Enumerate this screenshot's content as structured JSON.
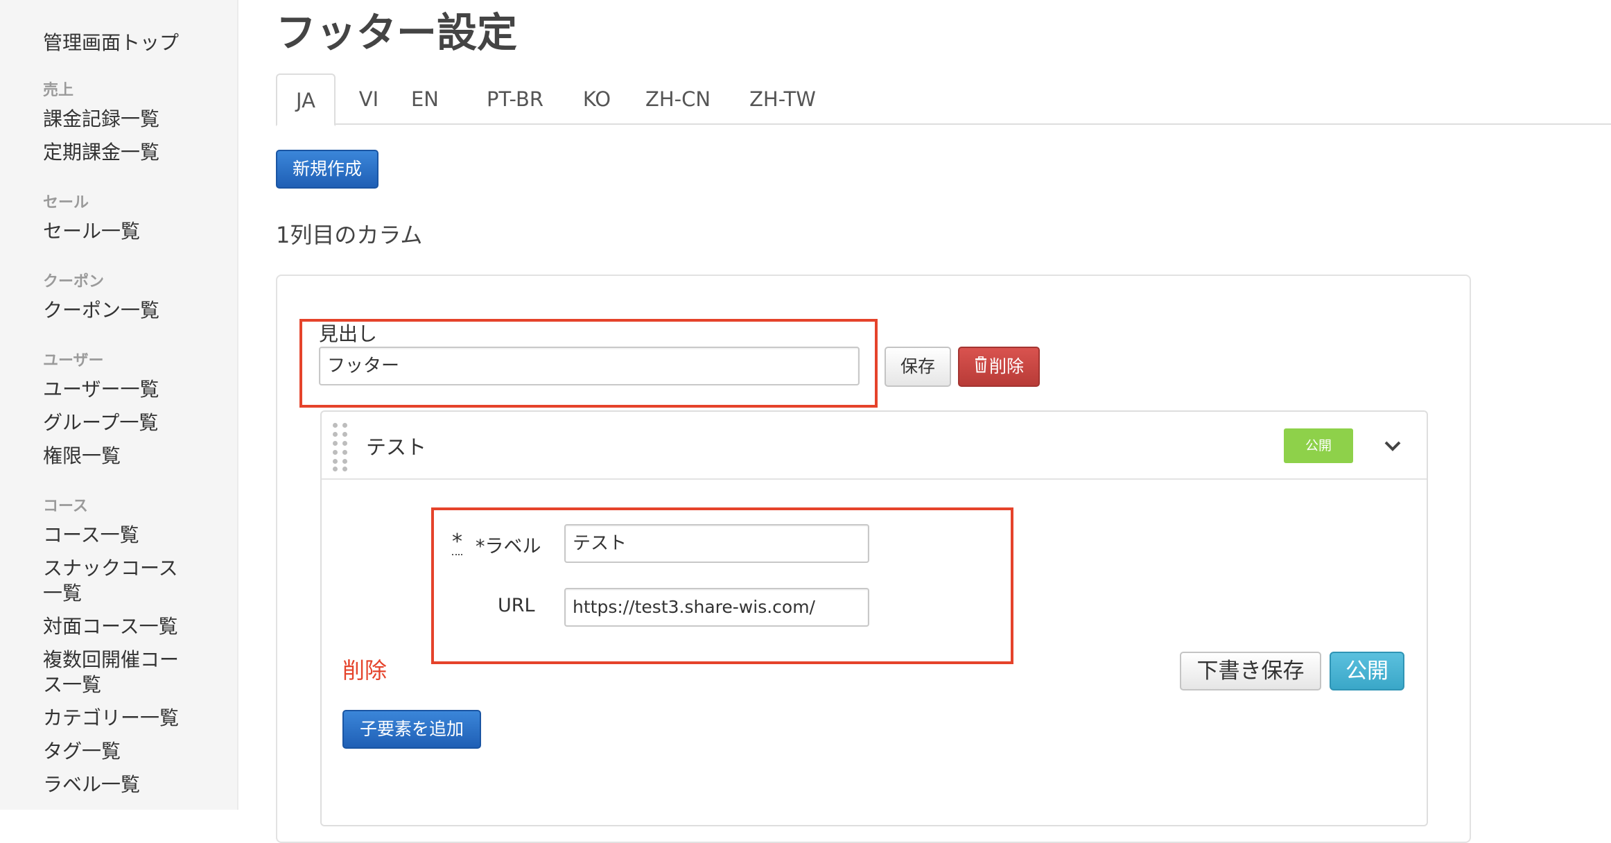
{
  "sidebar": {
    "top": "管理画面トップ",
    "sections": [
      {
        "heading": "売上",
        "items": [
          "課金記録一覧",
          "定期課金一覧"
        ]
      },
      {
        "heading": "セール",
        "items": [
          "セール一覧"
        ]
      },
      {
        "heading": "クーポン",
        "items": [
          "クーポン一覧"
        ]
      },
      {
        "heading": "ユーザー",
        "items": [
          "ユーザー一覧",
          "グループ一覧",
          "権限一覧"
        ]
      },
      {
        "heading": "コース",
        "items": [
          "コース一覧",
          "スナックコース",
          "一覧",
          "対面コース一覧",
          "複数回開催コー",
          "ス一覧",
          "カテゴリー一覧",
          "タグ一覧",
          "ラベル一覧"
        ]
      }
    ]
  },
  "page": {
    "title": "フッター設定",
    "tabs": [
      "JA",
      "VI",
      "EN",
      "PT-BR",
      "KO",
      "ZH-CN",
      "ZH-TW"
    ],
    "new_button": "新規作成",
    "column_title": "1列目のカラム"
  },
  "heading_field": {
    "label": "見出し",
    "value": "フッター",
    "save": "保存",
    "delete": "削除"
  },
  "item": {
    "title": "テスト",
    "status_badge": "公開",
    "label_mark": "*",
    "label_field_label": "*ラベル",
    "label_value": "テスト",
    "url_field_label": "URL",
    "url_value": "https://test3.share-wis.com/",
    "delete_link": "削除",
    "draft_save": "下書き保存",
    "publish": "公開",
    "add_child": "子要素を追加"
  },
  "colors": {
    "accent_blue": "#1f5fb5",
    "danger_red": "#d9534f",
    "highlight_red": "#e5432b",
    "publish_green": "#8ed14a",
    "publish_teal": "#3aa7c8"
  }
}
